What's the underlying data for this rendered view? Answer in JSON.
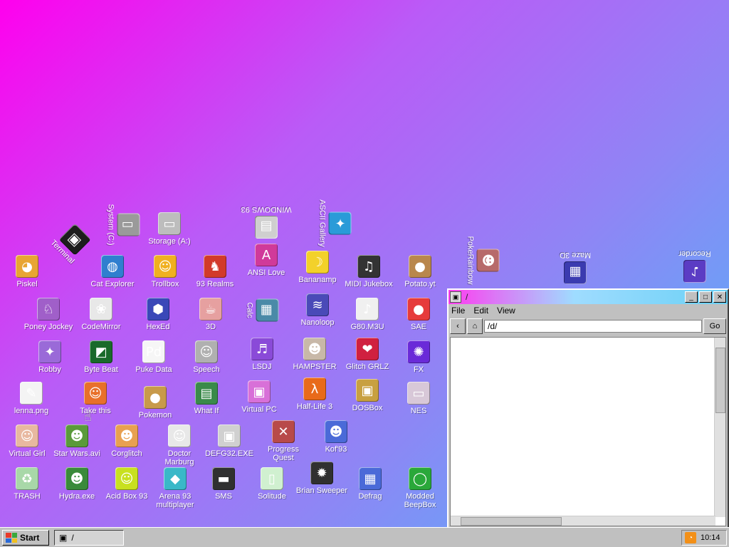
{
  "desktop": {
    "icons": [
      {
        "label": "Terminal",
        "icon": "terminal-icon",
        "glyph": "▣",
        "color": "#1d1d1d"
      },
      {
        "label": "System (C:)",
        "icon": "hard-drive-icon",
        "glyph": "▯",
        "color": "#9a9a9a"
      },
      {
        "label": "Storage (A:)",
        "icon": "floppy-drive-icon",
        "glyph": "▭",
        "color": "#bdbdbd"
      },
      {
        "label": "WINDOWS 93",
        "icon": "windows-folder-icon",
        "glyph": "▤",
        "color": "#cfcfcf"
      },
      {
        "label": "ASCII Gallery",
        "icon": "ascii-gallery-icon",
        "glyph": "✦",
        "color": "#2a9bd8"
      },
      {
        "label": "PokeRainbow",
        "icon": "pokerainbow-icon",
        "glyph": "☻",
        "color": "#b76a6a"
      },
      {
        "label": "Maze 3D",
        "icon": "maze-icon",
        "glyph": "▦",
        "color": "#3b3bb0"
      },
      {
        "label": "Recorder",
        "icon": "recorder-icon",
        "glyph": "♪",
        "color": "#5b3cc4"
      },
      {
        "label": "Piskel",
        "icon": "palette-icon",
        "glyph": "◕",
        "color": "#e8a533"
      },
      {
        "label": "Cat Explorer",
        "icon": "globe-icon",
        "glyph": "◍",
        "color": "#2f7fcf"
      },
      {
        "label": "Trollbox",
        "icon": "chat-icon",
        "glyph": "☺",
        "color": "#f0b020"
      },
      {
        "label": "93 Realms",
        "icon": "realms-icon",
        "glyph": "♞",
        "color": "#d23a2a"
      },
      {
        "label": "ANSI Love",
        "icon": "ansi-icon",
        "glyph": "A",
        "color": "#d03a9a"
      },
      {
        "label": "Bananamp",
        "icon": "banana-icon",
        "glyph": "☽",
        "color": "#f3d12a"
      },
      {
        "label": "MIDI Jukebox",
        "icon": "piano-icon",
        "glyph": "♫",
        "color": "#333333"
      },
      {
        "label": "Potato.yt",
        "icon": "potato-icon",
        "glyph": "●",
        "color": "#b9874c"
      },
      {
        "label": "Poney Jockey",
        "icon": "pony-icon",
        "glyph": "♘",
        "color": "#a05fc9"
      },
      {
        "label": "CodeMirror",
        "icon": "codemirror-icon",
        "glyph": "❀",
        "color": "#e8e8e8"
      },
      {
        "label": "HexEd",
        "icon": "hexed-icon",
        "glyph": "⬢",
        "color": "#3a48b8"
      },
      {
        "label": "3D",
        "icon": "teapot-icon",
        "glyph": "☕",
        "color": "#e6a0a0"
      },
      {
        "label": "Calc",
        "icon": "calculator-icon",
        "glyph": "▦",
        "color": "#4a8aa8"
      },
      {
        "label": "Nanoloop",
        "icon": "nanoloop-icon",
        "glyph": "≋",
        "color": "#4a4ab8"
      },
      {
        "label": "G80.M3U",
        "icon": "playlist-icon",
        "glyph": "♪",
        "color": "#f0f0f0"
      },
      {
        "label": "SAE",
        "icon": "sae-icon",
        "glyph": "●",
        "color": "#e63b3b"
      },
      {
        "label": "Robby",
        "icon": "robby-icon",
        "glyph": "✦",
        "color": "#9a6ad8"
      },
      {
        "label": "Byte Beat",
        "icon": "bytebeat-icon",
        "glyph": "◩",
        "color": "#1a6a2a"
      },
      {
        "label": "Puke Data",
        "icon": "pukedata-icon",
        "glyph": "Pd",
        "color": "#f6f6f6"
      },
      {
        "label": "Speech",
        "icon": "speech-icon",
        "glyph": "☺",
        "color": "#b0b0b0"
      },
      {
        "label": "LSDJ",
        "icon": "lsdj-icon",
        "glyph": "♬",
        "color": "#8a4ad8"
      },
      {
        "label": "HAMPSTER",
        "icon": "hampster-icon",
        "glyph": "☻",
        "color": "#c8b8a8"
      },
      {
        "label": "Glitch GRLZ",
        "icon": "lips-icon",
        "glyph": "❤",
        "color": "#d02040"
      },
      {
        "label": "FX",
        "icon": "fx-icon",
        "glyph": "✺",
        "color": "#6a2ad8"
      },
      {
        "label": "lenna.png",
        "icon": "image-file-icon",
        "glyph": "✎",
        "color": "#f4f4f4"
      },
      {
        "label": "Take this",
        "icon": "take-this-icon",
        "glyph": "☺",
        "color": "#e8702a"
      },
      {
        "label": "Pokemon",
        "icon": "pokemon-icon",
        "glyph": "●",
        "color": "#c89a4a"
      },
      {
        "label": "What If",
        "icon": "whatif-icon",
        "glyph": "▤",
        "color": "#3a8a4a"
      },
      {
        "label": "Virtual PC",
        "icon": "virtual-pc-icon",
        "glyph": "▣",
        "color": "#d870d8"
      },
      {
        "label": "Half-Life 3",
        "icon": "half-life-icon",
        "glyph": "λ",
        "color": "#e86a1a"
      },
      {
        "label": "DOSBox",
        "icon": "dosbox-icon",
        "glyph": "▣",
        "color": "#c8a040"
      },
      {
        "label": "NES",
        "icon": "nes-icon",
        "glyph": "▭",
        "color": "#d8c8d8"
      },
      {
        "label": "Virtual Girl",
        "icon": "virtual-girl-icon",
        "glyph": "☺",
        "color": "#e8b8a0"
      },
      {
        "label": "Star Wars.avi",
        "icon": "yoda-icon",
        "glyph": "☻",
        "color": "#5a9a3a"
      },
      {
        "label": "Corglitch",
        "icon": "corgi-icon",
        "glyph": "☻",
        "color": "#e8a050"
      },
      {
        "label": "Doctor Marburg",
        "icon": "doctor-icon",
        "glyph": "☺",
        "color": "#e8e8e8"
      },
      {
        "label": "DEFG32.EXE",
        "icon": "defrag-exe-icon",
        "glyph": "▣",
        "color": "#d0d0d0"
      },
      {
        "label": "Progress Quest",
        "icon": "swords-icon",
        "glyph": "✕",
        "color": "#b84a4a"
      },
      {
        "label": "Kof'93",
        "icon": "kof-icon",
        "glyph": "☻",
        "color": "#4a6ad8"
      },
      {
        "label": "TRASH",
        "icon": "trash-icon",
        "glyph": "♻",
        "color": "#a8d8a8"
      },
      {
        "label": "Hydra.exe",
        "icon": "hydra-icon",
        "glyph": "☻",
        "color": "#3a8a3a"
      },
      {
        "label": "Acid Box 93",
        "icon": "acid-smiley-icon",
        "glyph": "☺",
        "color": "#c8e020"
      },
      {
        "label": "Arena 93 multiplayer",
        "icon": "arena-icon",
        "glyph": "◆",
        "color": "#3ab8c8"
      },
      {
        "label": "SMS",
        "icon": "sms-icon",
        "glyph": "▬",
        "color": "#303030"
      },
      {
        "label": "Solitude",
        "icon": "solitude-icon",
        "glyph": "▯",
        "color": "#d0f0d0"
      },
      {
        "label": "Brian Sweeper",
        "icon": "mine-icon",
        "glyph": "✹",
        "color": "#303030"
      },
      {
        "label": "Defrag",
        "icon": "defrag-icon",
        "glyph": "▦",
        "color": "#4a6ad8"
      },
      {
        "label": "Modded BeepBox",
        "icon": "beepbox-icon",
        "glyph": "◯",
        "color": "#2aa83a"
      }
    ]
  },
  "window": {
    "title": "/",
    "menu": [
      "File",
      "Edit",
      "View"
    ],
    "back_glyph": "‹",
    "home_glyph": "⌂",
    "address": "/d/",
    "go_label": "Go",
    "min_glyph": "_",
    "max_glyph": "□",
    "close_glyph": "✕"
  },
  "taskbar": {
    "start_label": "Start",
    "items": [
      {
        "label": "/"
      }
    ],
    "clock": "10:14",
    "colors": {
      "flag_red": "#e83a2a",
      "flag_green": "#3aa83a",
      "flag_blue": "#2a6ad8",
      "flag_yellow": "#f0c020"
    }
  }
}
